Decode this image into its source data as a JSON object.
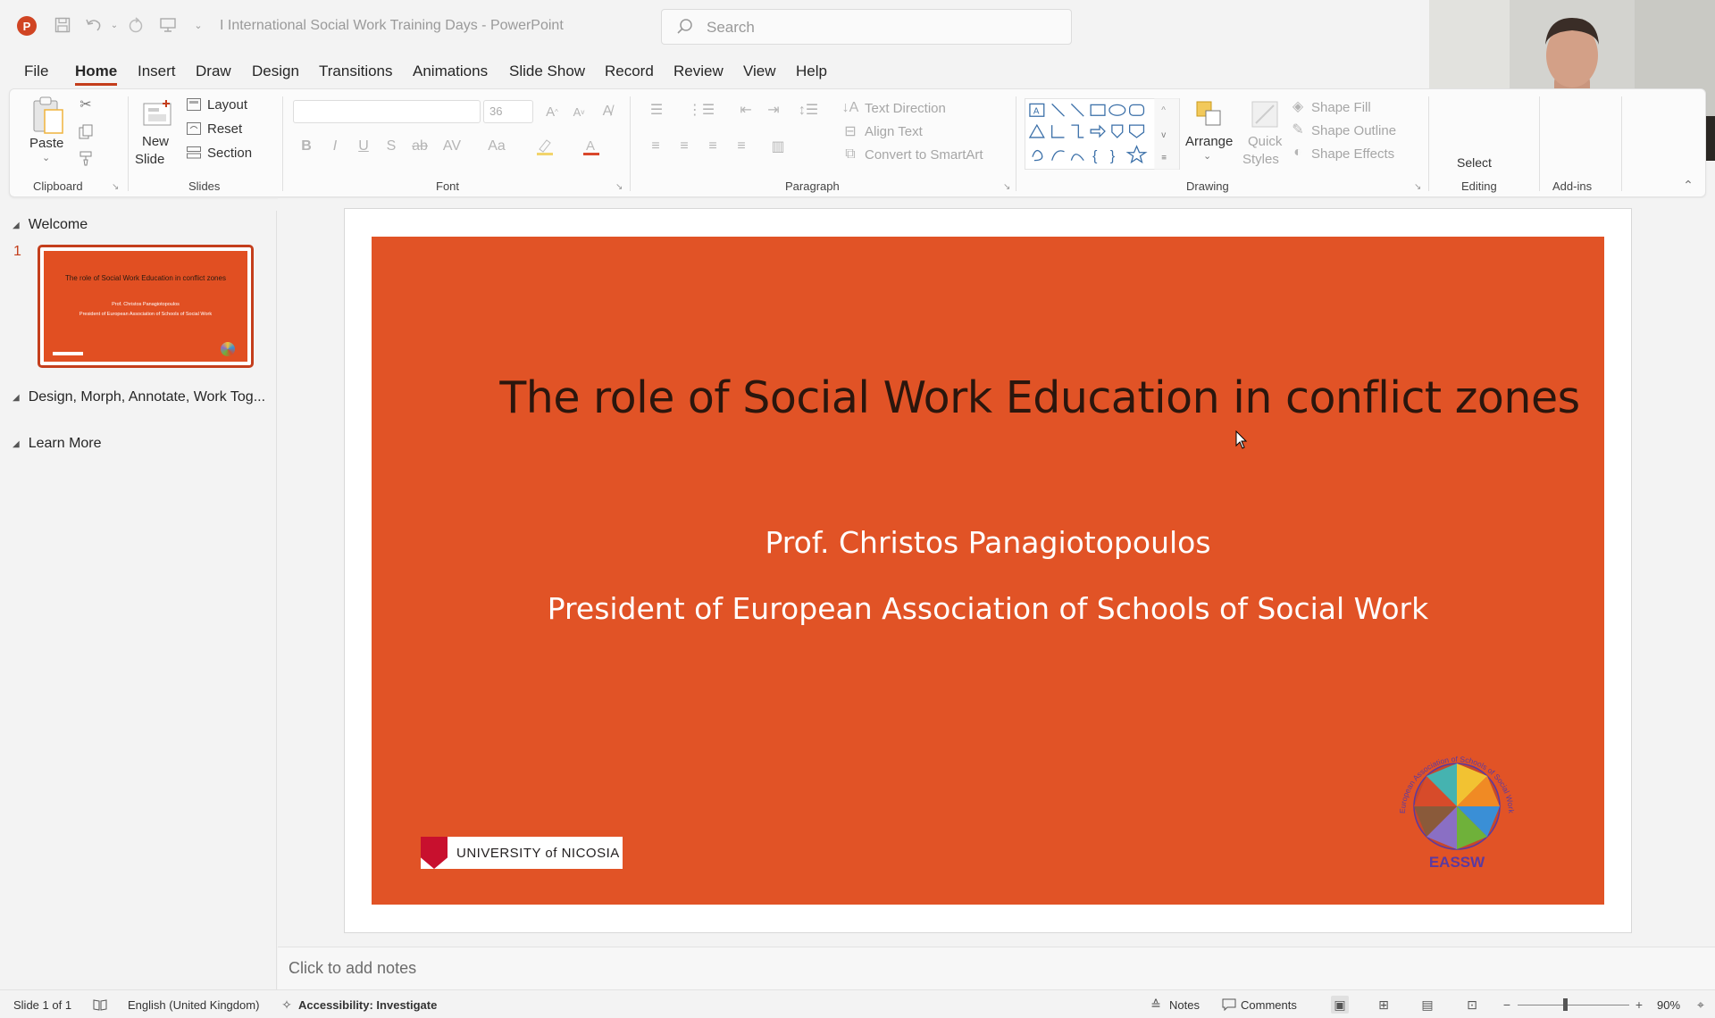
{
  "app": {
    "doc_title": "I International Social Work Training Days  -  PowerPoint",
    "search_placeholder": "Search"
  },
  "tabs": [
    "File",
    "Home",
    "Insert",
    "Draw",
    "Design",
    "Transitions",
    "Animations",
    "Slide Show",
    "Record",
    "Review",
    "View",
    "Help"
  ],
  "ribbon": {
    "clipboard": {
      "paste": "Paste",
      "label": "Clipboard"
    },
    "slides": {
      "new_slide_1": "New",
      "new_slide_2": "Slide",
      "layout": "Layout",
      "reset": "Reset",
      "section": "Section",
      "label": "Slides"
    },
    "font": {
      "size": "36",
      "label": "Font"
    },
    "paragraph": {
      "text_direction": "Text Direction",
      "align_text": "Align Text",
      "convert_smartart": "Convert to SmartArt",
      "label": "Paragraph"
    },
    "drawing": {
      "arrange": "Arrange",
      "quick_styles_1": "Quick",
      "quick_styles_2": "Styles",
      "shape_fill": "Shape Fill",
      "shape_outline": "Shape Outline",
      "shape_effects": "Shape Effects",
      "label": "Drawing"
    },
    "editing": {
      "select": "Select",
      "label": "Editing"
    },
    "addins": {
      "label": "Add-ins"
    }
  },
  "left_panel": {
    "sections": [
      "Welcome",
      "Design, Morph, Annotate, Work Tog...",
      "Learn More"
    ],
    "slide_number": "1",
    "thumb": {
      "title": "The role of Social Work Education in conflict zones",
      "author": "Prof. Christos Panagiotopoulos",
      "role": "President of European Association of Schools of Social Work"
    }
  },
  "slide": {
    "title": "The role of Social Work Education in conflict zones",
    "author": "Prof. Christos Panagiotopoulos",
    "role": "President of European Association of Schools of Social Work",
    "university_logo": "UNIVERSITY of NICOSIA",
    "eassw_logo": "EASSW",
    "eassw_ring": "European Association of Schools of Social Work",
    "background": "#e15326"
  },
  "notes": {
    "placeholder": "Click to add notes"
  },
  "status": {
    "slide_of": "Slide 1 of 1",
    "language": "English (United Kingdom)",
    "accessibility": "Accessibility: Investigate",
    "notes": "Notes",
    "comments": "Comments",
    "zoom": "90%"
  },
  "colors": {
    "accent": "#c43e1c",
    "slide_bg": "#e15326"
  },
  "icons": [
    "powerpoint-logo",
    "save-icon",
    "undo-icon",
    "redo-icon",
    "presenter-icon",
    "search-icon",
    "paste-icon",
    "cut-icon",
    "copy-icon",
    "format-painter-icon"
  ]
}
